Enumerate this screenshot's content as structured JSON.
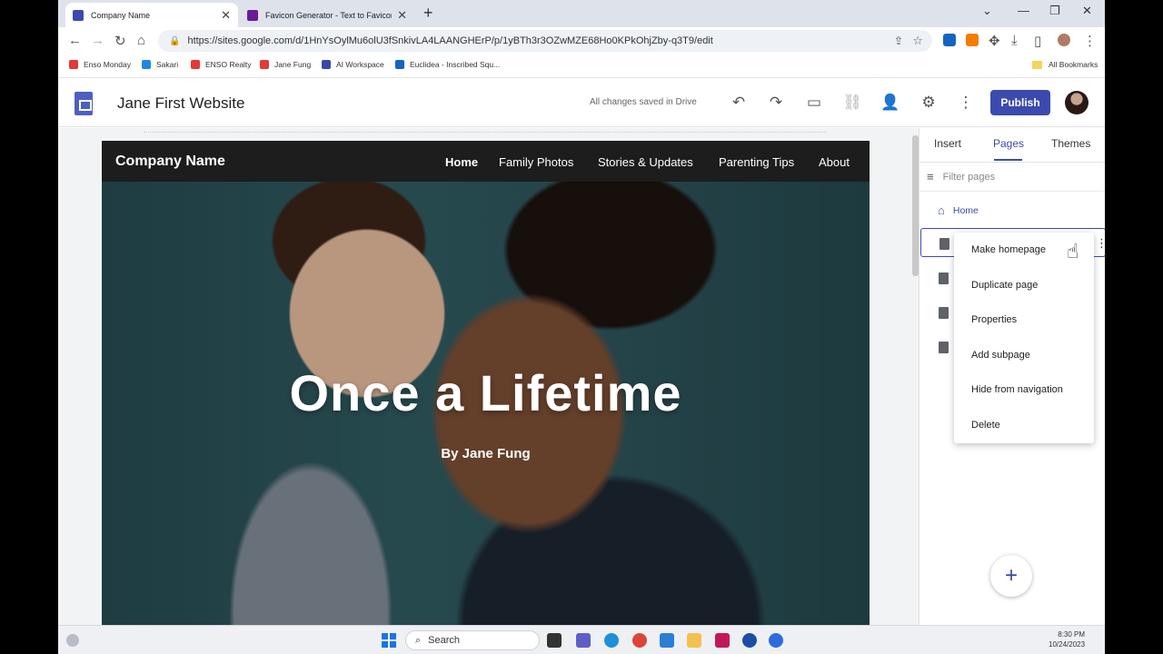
{
  "browser": {
    "tabs": [
      {
        "title": "Company Name",
        "favicon_color": "#3c4aae",
        "active": true
      },
      {
        "title": "Favicon Generator - Text to Favicon - f...",
        "favicon_color": "#6a1b9a",
        "active": false
      }
    ],
    "url": "https://sites.google.com/d/1HnYsOylMu6olU3fSnkivLA4LAANGHErP/p/1yBTh3r3OZwMZE68Ho0KPkOhjZby-q3T9/edit",
    "bookmarks": [
      {
        "label": "Enso Monday",
        "color": "#e53935"
      },
      {
        "label": "Sakari",
        "color": "#1e88e5"
      },
      {
        "label": "ENSO Realty",
        "color": "#e53935"
      },
      {
        "label": "Jane Fung",
        "color": "#e53935"
      },
      {
        "label": "AI Workspace",
        "color": "#3949ab"
      },
      {
        "label": "Euclidea - Inscribed Squ...",
        "color": "#1565c0"
      }
    ],
    "all_bookmarks": "All Bookmarks"
  },
  "sites": {
    "doc_title": "Jane First Website",
    "save_status": "All changes saved in Drive",
    "publish_label": "Publish",
    "accent": "#3c4aae"
  },
  "website": {
    "brand": "Company Name",
    "nav": [
      "Home",
      "Family Photos",
      "Stories & Updates",
      "Parenting Tips",
      "About"
    ],
    "headline": "Once a Lifetime",
    "byline": "By Jane Fung"
  },
  "panel": {
    "tabs": [
      "Insert",
      "Pages",
      "Themes"
    ],
    "active_tab": "Pages",
    "filter_placeholder": "Filter pages",
    "home_label": "Home"
  },
  "context_menu": {
    "items": [
      "Make homepage",
      "Duplicate page",
      "Properties",
      "Add subpage",
      "Hide from navigation",
      "Delete"
    ]
  },
  "taskbar": {
    "search_label": "Search",
    "time": "8:30 PM",
    "date": "10/24/2023"
  }
}
